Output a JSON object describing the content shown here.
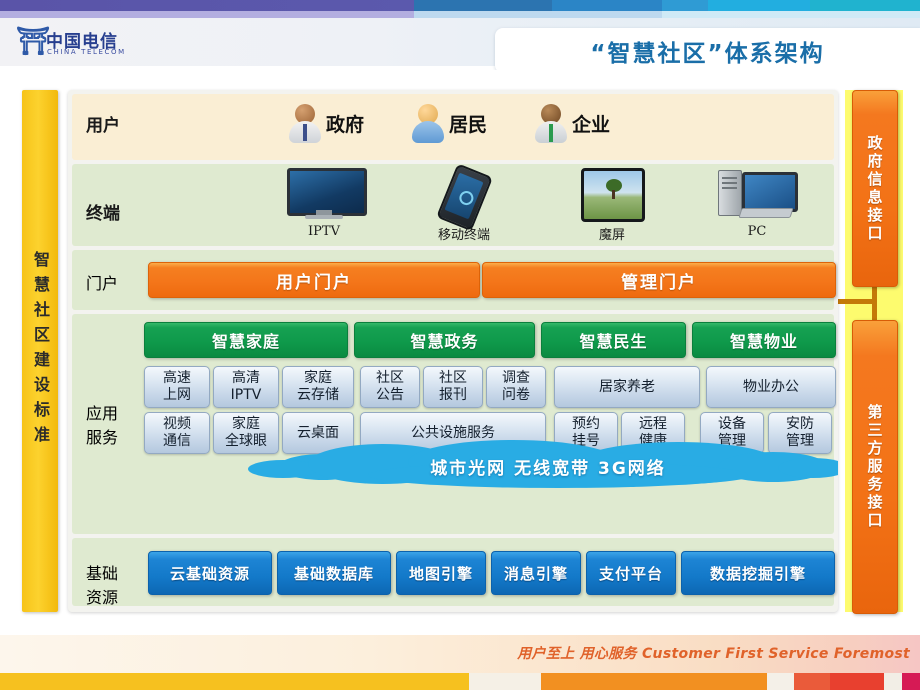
{
  "header": {
    "logo_cn": "中国电信",
    "logo_en": "CHINA TELECOM",
    "title": "“智慧社区”体系架构"
  },
  "left_sidebar": {
    "label": "智慧社区建设标准"
  },
  "right_sidebar": {
    "gov_interface": "政府信息接口",
    "third_party_interface": "第三方服务接口"
  },
  "rows": {
    "user": {
      "label": "用户",
      "items": [
        {
          "name": "政府",
          "icon": "user-avatar-government"
        },
        {
          "name": "居民",
          "icon": "user-avatar-resident"
        },
        {
          "name": "企业",
          "icon": "user-avatar-enterprise"
        }
      ]
    },
    "terminal": {
      "label": "终端",
      "items": [
        {
          "name": "IPTV",
          "icon": "tv-monitor-icon"
        },
        {
          "name": "移动终端",
          "icon": "mobile-phone-icon"
        },
        {
          "name": "魔屏",
          "icon": "tablet-icon"
        },
        {
          "name": "PC",
          "icon": "desktop-pc-icon"
        }
      ]
    },
    "portal": {
      "label": "门户",
      "items": [
        "用户门户",
        "管理门户"
      ]
    },
    "application": {
      "label": "应用服务",
      "categories": [
        "智慧家庭",
        "智慧政务",
        "智慧民生",
        "智慧物业"
      ],
      "row1": [
        "高速\n上网",
        "高清\nIPTV",
        "家庭\n云存储",
        "社区\n公告",
        "社区\n报刊",
        "调查\n问卷",
        "居家养老",
        "物业办公"
      ],
      "row2": [
        "视频\n通信",
        "家庭\n全球眼",
        "云桌面",
        "公共设施服务",
        "预约\n挂号",
        "远程\n健康",
        "设备\n管理",
        "安防\n管理"
      ]
    },
    "network": {
      "label": "城市光网  无线宽带  3G网络"
    },
    "base": {
      "label": "基础资源",
      "items": [
        "云基础资源",
        "基础数据库",
        "地图引擎",
        "消息引擎",
        "支付平台",
        "数据挖掘引擎"
      ]
    }
  },
  "footer": {
    "slogan": "用户至上 用心服务 Customer First Service Foremost"
  },
  "colors": {
    "accent_orange": "#f4761a",
    "accent_green": "#0f9a4b",
    "accent_blue": "#1379c9",
    "sidebar_yellow": "#f6c318",
    "cloud_blue": "#29ace4",
    "title_blue": "#1a6ea8"
  }
}
